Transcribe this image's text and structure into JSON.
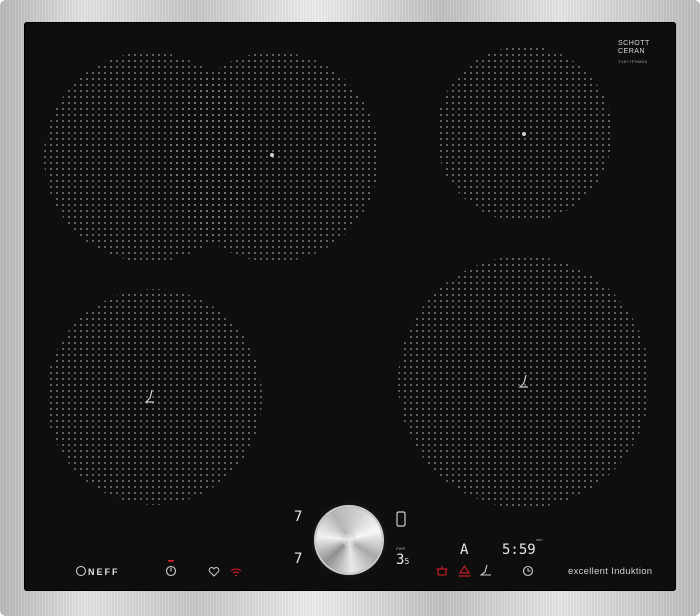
{
  "brand": {
    "glass_maker_line1": "SCHOTT",
    "glass_maker_line2": "CERAN",
    "glass_code": "T1877FHM00",
    "cooktop_brand": "NEFF",
    "tagline": "excellent Induktion"
  },
  "controls": {
    "left_level_top": "7",
    "left_level_bottom": "7",
    "center_power_label": "PWR",
    "center_power_value": "3",
    "center_power_decimal": "5",
    "auto_indicator": "A",
    "timer_label": "min",
    "timer_value": "5:59"
  },
  "icons": {
    "power": "power-icon",
    "favorite": "heart-icon",
    "wifi": "wifi-icon",
    "pot": "pot-icon",
    "hob_link": "hob-link-icon",
    "frying_sensor": "frying-sensor-icon",
    "timer": "clock-icon",
    "phone": "phone-icon",
    "knob": "twist-knob"
  },
  "colors": {
    "glass": "#0e0e0e",
    "zone_dots": "#9a9a9a",
    "indicator_red": "#e0202a",
    "display": "#e8e8e8"
  }
}
